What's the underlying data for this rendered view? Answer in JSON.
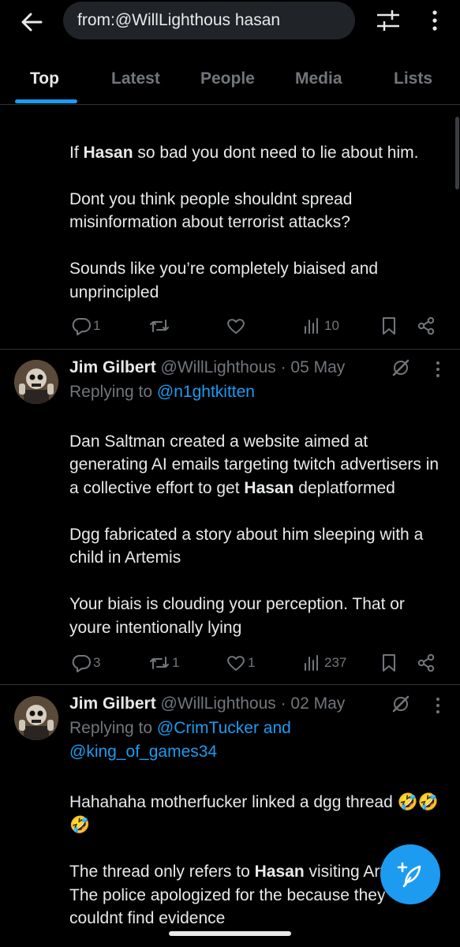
{
  "search": {
    "query": "from:@WillLighthous hasan"
  },
  "tabs": [
    {
      "label": "Top"
    },
    {
      "label": "Latest"
    },
    {
      "label": "People"
    },
    {
      "label": "Media"
    },
    {
      "label": "Lists"
    }
  ],
  "tweets": [
    {
      "paragraphs": [
        [
          "If ",
          "Hasan",
          " so bad you dont need to lie about him."
        ],
        [
          "Dont you think people shouldnt spread misinformation about terrorist attacks?"
        ],
        [
          "Sounds like you’re completely biaised and unprincipled"
        ]
      ],
      "replies": "1",
      "retweets": "",
      "likes": "",
      "views": "10"
    },
    {
      "name": "Jim Gilbert",
      "handle": "@WillLighthous",
      "date": "· 05 May",
      "replying_prefix": "Replying to ",
      "replying_to": "@n1ghtkitten",
      "paragraphs": [
        [
          "Dan Saltman created a website aimed at generating AI emails targeting twitch advertisers in a collective effort to get ",
          "Hasan",
          " deplatformed"
        ],
        [
          "Dgg fabricated a story about him sleeping with a child in Artemis"
        ],
        [
          "Your biais is clouding your perception. That or youre intentionally lying"
        ]
      ],
      "replies": "3",
      "retweets": "1",
      "likes": "1",
      "views": "237"
    },
    {
      "name": "Jim Gilbert",
      "handle": "@WillLighthous",
      "date": "· 02 May",
      "replying_prefix": "Replying to ",
      "replying_to": "@CrimTucker and",
      "replying_to_2": "@king_of_games34",
      "paragraphs": [
        [
          "Hahahaha motherfucker linked a dgg thread 🤣🤣🤣"
        ],
        [
          "The thread only refers to ",
          "Hasan",
          " visiting Artemis. The police apologized for the ",
          "",
          "because they couldnt find evidence"
        ]
      ]
    }
  ],
  "icons": {
    "back": "arrow-left-icon",
    "filter": "sliders-icon",
    "more": "vertical-dots-icon",
    "reply": "speech-bubble-icon",
    "retweet": "retweet-icon",
    "like": "heart-icon",
    "views": "bar-chart-icon",
    "bookmark": "bookmark-icon",
    "share": "share-icon",
    "grok": "grok-slash-icon",
    "compose": "feather-plus-icon"
  },
  "colors": {
    "accent": "#1d9bf0",
    "background": "#000000",
    "muted": "#71767b",
    "text": "#e7e9ea"
  }
}
